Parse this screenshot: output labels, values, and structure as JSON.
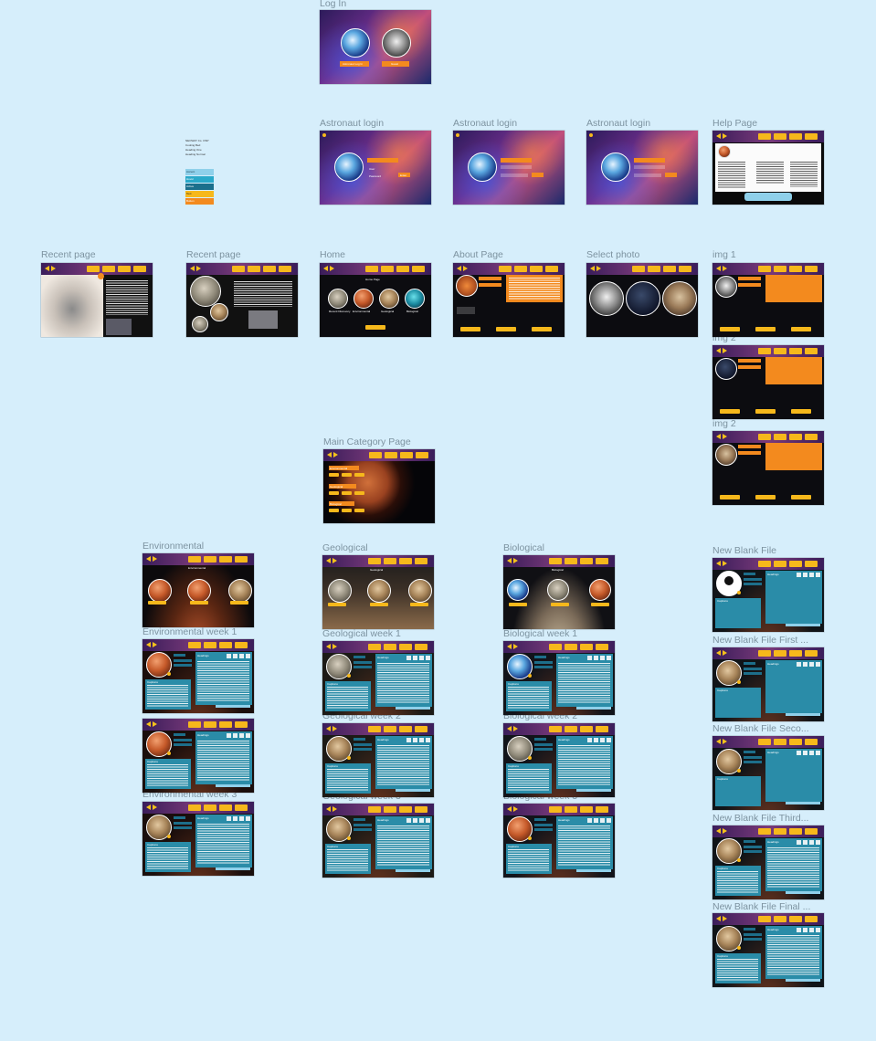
{
  "canvas": {
    "background": "#d6eefb",
    "frame_labels": {
      "login": "Log In",
      "astro1": "Astronaut login",
      "astro2": "Astronaut login",
      "astro3": "Astronaut login",
      "help": "Help Page",
      "recent1": "Recent page",
      "recent2": "Recent page",
      "home": "Home",
      "about": "About Page",
      "select": "Select photo",
      "img1": "img 1",
      "img2a": "img 2",
      "img2b": "img 2",
      "maincat": "Main Category Page",
      "env": "Environmental",
      "geo": "Geological",
      "bio": "Biological",
      "newblank": "New Blank File",
      "env_w1": "Environmental week 1",
      "geo_w1": "Geological week 1",
      "bio_w1": "Biological week 1",
      "newblank_first": "New Blank File First ...",
      "env_w2": "Environmental week 2",
      "geo_w2": "Geological week 2",
      "bio_w2": "Biological week 2",
      "newblank_second": "New Blank File Seco...",
      "env_w3": "Environmental week 3",
      "geo_w3": "Geological week 3",
      "bio_w3": "Biological week 3",
      "newblank_third": "New Blank File Third...",
      "newblank_final": "New Blank File Final ..."
    }
  },
  "legend": {
    "items": [
      "Accent",
      "Hover",
      "Active",
      "Text",
      "Button"
    ],
    "colors": [
      "#8fd0ea",
      "#2aa9c9",
      "#1b6f8c",
      "#f6b81b",
      "#f38a1e"
    ],
    "notes": [
      "NEOWAY Cs. OSP",
      "Cooling Bed",
      "Heading One",
      "Heading Normal"
    ]
  },
  "frames": {
    "login": {
      "buttons": [
        "Astronaut Log In",
        "Guest"
      ]
    },
    "astronaut_login": {
      "fields": [
        "User",
        "Password"
      ],
      "button": "Enter"
    },
    "home": {
      "title": "Home Page",
      "categories": [
        "Recent Discovery",
        "Environmental",
        "Geological",
        "Biological"
      ]
    },
    "main_category": {
      "sections": [
        "Environmental",
        "Geological",
        "Biological"
      ]
    },
    "category_pages": {
      "environmental": "Environmental",
      "geological": "Geological",
      "biological": "Biological"
    },
    "week_page": {
      "headings": "Headings",
      "captions": "Captions"
    }
  }
}
